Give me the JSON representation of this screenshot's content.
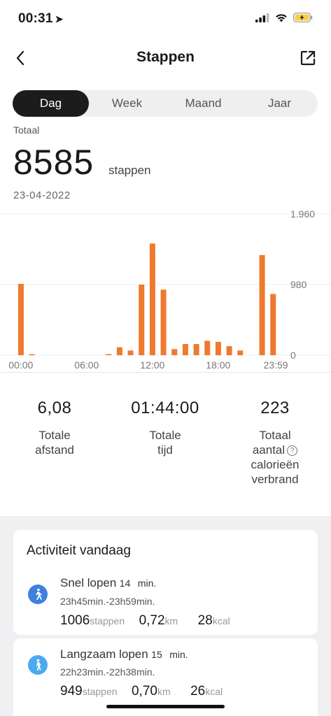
{
  "status_bar": {
    "time": "00:31",
    "location_arrow": "➤"
  },
  "header": {
    "title": "Stappen",
    "back_icon": "chevron-left-icon",
    "share_icon": "share-icon"
  },
  "tabs": [
    {
      "label": "Dag",
      "active": true
    },
    {
      "label": "Week",
      "active": false
    },
    {
      "label": "Maand",
      "active": false
    },
    {
      "label": "Jaar",
      "active": false
    }
  ],
  "summary": {
    "total_label": "Totaal",
    "steps": "8585",
    "unit": "stappen",
    "date": "23-04-2022"
  },
  "chart_data": {
    "type": "bar",
    "title": "",
    "xlabel": "",
    "ylabel": "",
    "ylim": [
      0,
      1960
    ],
    "y_ticks": [
      "1.960",
      "980",
      "0"
    ],
    "x_ticks": [
      "00:00",
      "06:00",
      "12:00",
      "18:00",
      "23:59"
    ],
    "x_range": [
      0,
      24
    ],
    "bar_color": "#ef7a2e",
    "points": [
      {
        "x": 0.25,
        "y": 990
      },
      {
        "x": 1.25,
        "y": 12
      },
      {
        "x": 8.25,
        "y": 12
      },
      {
        "x": 9.25,
        "y": 110
      },
      {
        "x": 10.25,
        "y": 65
      },
      {
        "x": 11.25,
        "y": 980
      },
      {
        "x": 12.25,
        "y": 1550
      },
      {
        "x": 13.25,
        "y": 910
      },
      {
        "x": 14.25,
        "y": 85
      },
      {
        "x": 15.25,
        "y": 155
      },
      {
        "x": 16.25,
        "y": 155
      },
      {
        "x": 17.25,
        "y": 200
      },
      {
        "x": 18.25,
        "y": 185
      },
      {
        "x": 19.25,
        "y": 125
      },
      {
        "x": 20.25,
        "y": 65
      },
      {
        "x": 22.25,
        "y": 1390
      },
      {
        "x": 23.25,
        "y": 850
      }
    ]
  },
  "stats": [
    {
      "value": "6,08",
      "label_lines": [
        "Totale",
        "afstand"
      ]
    },
    {
      "value": "01:44:00",
      "label_lines": [
        "Totale",
        "tijd"
      ]
    },
    {
      "value": "223",
      "label_lines": [
        "Totaal",
        "aantal",
        "calorieën",
        "verbrand"
      ]
    }
  ],
  "activity": {
    "title": "Activiteit vandaag",
    "items": [
      {
        "name": "Snel lopen",
        "minutes": "14",
        "min_unit": "min.",
        "range": "23h45min.-23h59min.",
        "steps": "1006",
        "steps_unit": "stappen",
        "distance": "0,72",
        "distance_unit": "km",
        "kcal": "28",
        "kcal_unit": "kcal",
        "icon": "fast-walk-icon",
        "icon_color": "#3f7fe0"
      },
      {
        "name": "Langzaam lopen",
        "minutes": "15",
        "min_unit": "min.",
        "range": "22h23min.-22h38min.",
        "steps": "949",
        "steps_unit": "stappen",
        "distance": "0,70",
        "distance_unit": "km",
        "kcal": "26",
        "kcal_unit": "kcal",
        "icon": "slow-walk-icon",
        "icon_color": "#4aaaf0"
      }
    ]
  }
}
